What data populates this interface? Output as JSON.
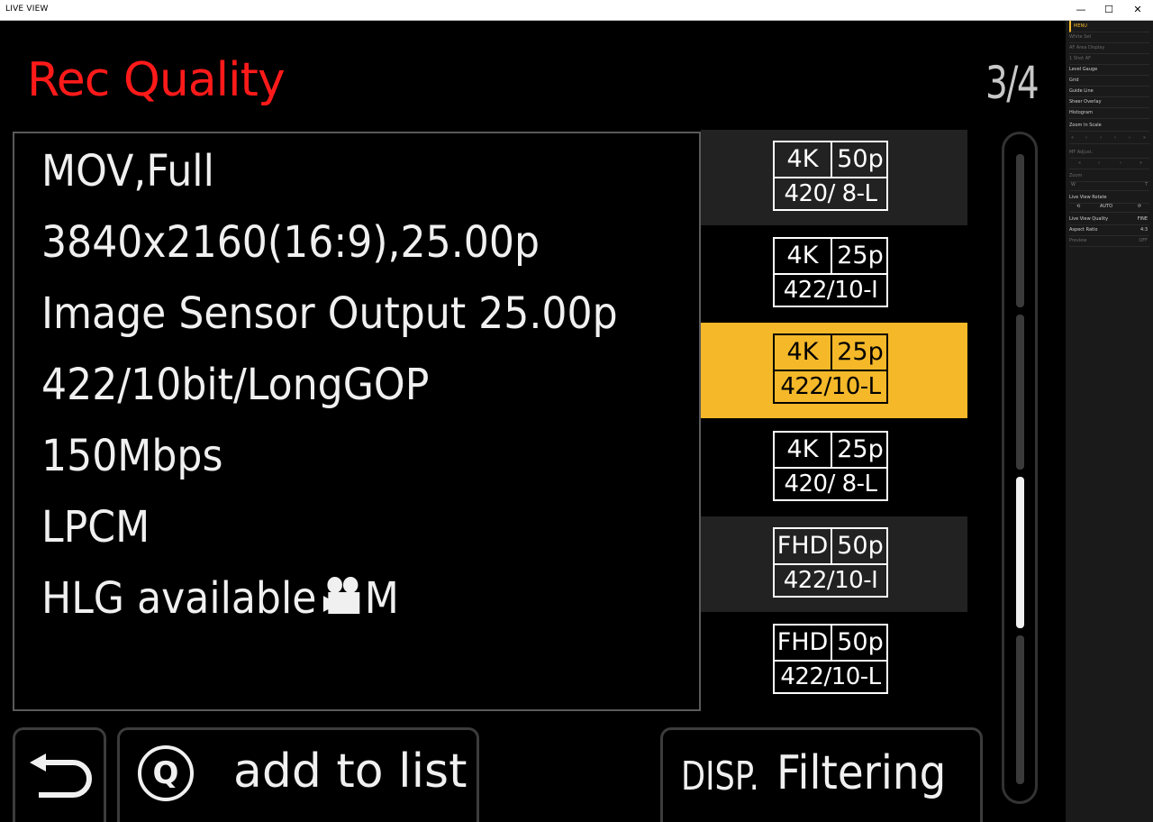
{
  "window": {
    "title": "LIVE VIEW",
    "minimize": "—",
    "maximize": "☐",
    "close": "✕"
  },
  "screen": {
    "title": "Rec Quality",
    "page_indicator": "3/4",
    "info_lines": [
      "MOV,Full",
      "3840x2160(16:9),25.00p",
      "Image Sensor Output 25.00p",
      "422/10bit/LongGOP",
      "150Mbps",
      "LPCM",
      "HLG available"
    ],
    "hlg_suffix": "M",
    "list_items": [
      {
        "res": "4K",
        "fps": "50p",
        "fmt": "420/ 8-L"
      },
      {
        "res": "4K",
        "fps": "25p",
        "fmt": "422/10-I"
      },
      {
        "res": "4K",
        "fps": "25p",
        "fmt": "422/10-L"
      },
      {
        "res": "4K",
        "fps": "25p",
        "fmt": "420/ 8-L"
      },
      {
        "res": "FHD",
        "fps": "50p",
        "fmt": "422/10-I"
      },
      {
        "res": "FHD",
        "fps": "50p",
        "fmt": "422/10-L"
      }
    ],
    "selected_index": 2,
    "buttons": {
      "add_label": "add to list",
      "q_label": "Q",
      "disp_label": "DISP.",
      "filter_label": "Filtering"
    },
    "colors": {
      "title": "#ff1a1a",
      "selected": "#f4b829"
    }
  },
  "side_panel": {
    "header": "MENU",
    "items": [
      {
        "label": "White Set",
        "dim": true
      },
      {
        "label": "AF Area Display",
        "dim": true
      },
      {
        "label": "1 Shot AF",
        "dim": true
      },
      {
        "label": "Level Gauge",
        "dim": false
      },
      {
        "label": "Grid",
        "dim": false
      },
      {
        "label": "Guide Line",
        "dim": false
      },
      {
        "label": "Sheer Overlay",
        "dim": false
      },
      {
        "label": "Histogram",
        "dim": false
      },
      {
        "label": "Zoom In Scale",
        "dim": false
      }
    ],
    "mf_adjust": "MF Adjust.",
    "zoom": "Zoom",
    "zoom_w": "W",
    "zoom_t": "T",
    "live_view_rotate": "Live View Rotate",
    "auto": "AUTO",
    "live_view_quality": "Live View Quality",
    "live_view_quality_val": "FINE",
    "aspect_ratio": "Aspect Ratio",
    "aspect_ratio_val": "4:3",
    "preview": "Preview",
    "preview_val": "OFF"
  }
}
